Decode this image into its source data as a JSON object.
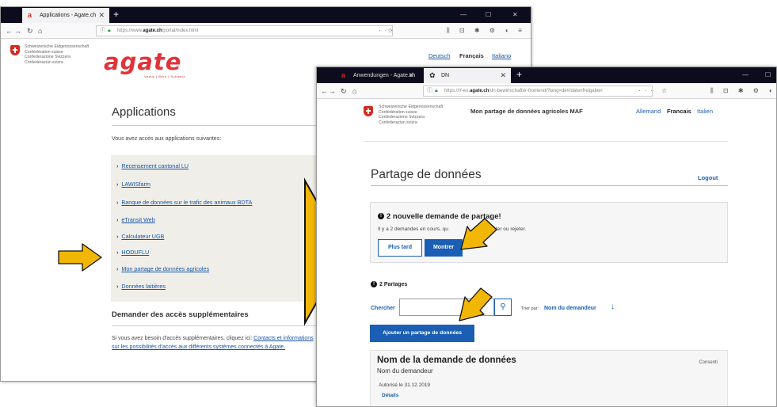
{
  "window1": {
    "tab_title": "Applications - Agate.ch",
    "url_prefix": "https://www.",
    "url_domain": "agate.ch",
    "url_rest": "/portal/index.html",
    "confed_text": "Schweizerische Eidgenossenschaft\nConfédération suisse\nConfederazione Svizzera\nConfederaziun svizra",
    "logo_text": "agate",
    "logo_sub": "Vaduz | Bern | Schweiz",
    "languages": [
      "Deutsch",
      "Français",
      "Italiano"
    ],
    "heading": "Applications",
    "intro": "Vous avez accès aux applications suivantes:",
    "apps": [
      "Recensement cantonal LU",
      "LAWISfarm",
      "Banque de données sur le trafic des animaux BDTA",
      "eTransit Web",
      "Calculateur UGB",
      "HODUFLU",
      "Mon partage de données agricoles",
      "Données laitières"
    ],
    "request_heading": "Demander des accès supplémentaires",
    "request_text_pre": "Si vous avez besoin d'accès supplémentaires, cliquez ici: ",
    "request_link": "Contacts et informations sur les possibilités d'accès aux différents systèmes connectés à Agate."
  },
  "window2": {
    "tab1_title": "Anwendungen - Agate.ch",
    "tab2_title": "DN",
    "url_prefix": "https://rf-en.",
    "url_domain": "agate.ch",
    "url_rest": "/dn-bewirtschafter-frontend/?lang=de#/datenfreigaben",
    "confed_text": "Schweizerische Eidgenossenschaft\nConfédération suisse\nConfederazione Svizzera\nConfederaziun svizra",
    "app_title": "Mon partage de données agricoles MAF",
    "languages": [
      "Allemand",
      "Francais",
      "Italien"
    ],
    "heading": "Partage de données",
    "logout": "Logout",
    "notice_title": "2 nouvelle demande de partage!",
    "notice_text": "Il y a 2 demandes en cours, qu",
    "notice_text_end": "ez accepter ou rejeter.",
    "btn_later": "Plus tard",
    "btn_show": "Montrer",
    "partages": "2 Partages",
    "search_label": "Chercher",
    "sort_label": "Trier par:",
    "sort_value": "Nom du demandeur",
    "btn_add": "Ajouter un partage de données",
    "card_title": "Nom de la demande de données",
    "card_sub": "Nom du demandeur",
    "card_status": "Consenti",
    "card_date": "Autorisé le 31.12.2019",
    "card_link": "Détails"
  },
  "colors": {
    "accent_blue": "#1a5fb4",
    "arrow_yellow": "#f2b705",
    "swiss_red": "#d52b1e",
    "agate_red": "#e0343a"
  }
}
